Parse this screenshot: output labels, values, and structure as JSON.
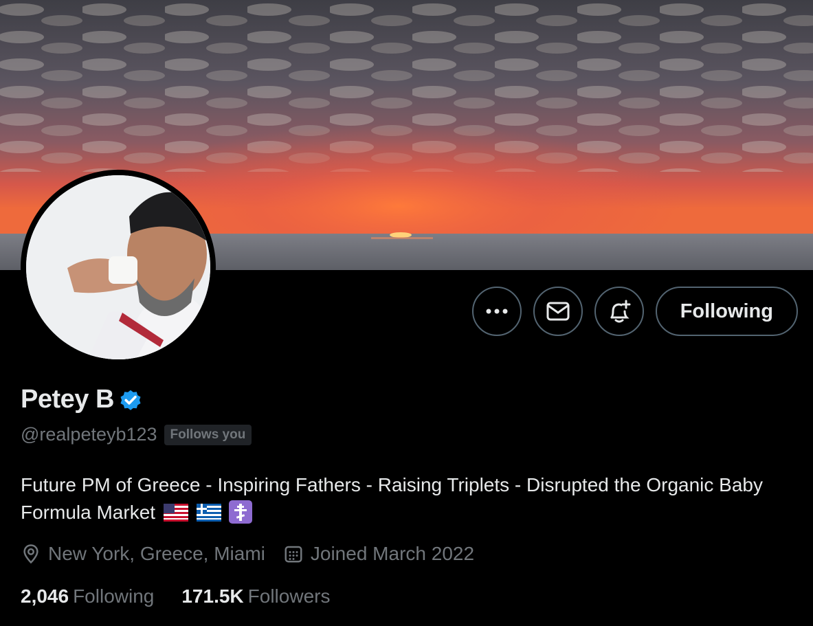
{
  "profile": {
    "display_name": "Petey B",
    "handle": "@realpeteyb123",
    "follows_you_badge": "Follows you",
    "bio_text": "Future PM of Greece - Inspiring Fathers - Raising Triplets - Disrupted the Organic Baby Formula Market",
    "bio_emojis": [
      "us-flag-icon",
      "greece-flag-icon",
      "orthodox-cross-icon"
    ],
    "location": "New York, Greece, Miami",
    "joined": "Joined March 2022",
    "following_count": "2,046",
    "following_label": "Following",
    "followers_count": "171.5K",
    "followers_label": "Followers",
    "verified": true
  },
  "actions": {
    "more_icon": "more-icon",
    "message_icon": "envelope-icon",
    "notify_icon": "bell-plus-icon",
    "follow_button_label": "Following"
  },
  "colors": {
    "background": "#000000",
    "primary_text": "#e7e9ea",
    "secondary_text": "#71767b",
    "verified_badge": "#1d9bf0",
    "button_border": "#536471"
  }
}
